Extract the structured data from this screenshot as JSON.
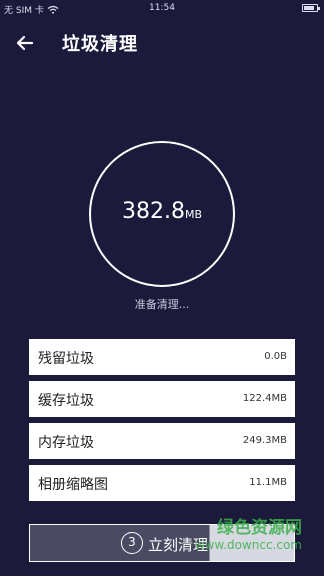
{
  "status_bar": {
    "carrier": "无 SIM 卡",
    "time": "11:54"
  },
  "header": {
    "title": "垃圾清理"
  },
  "summary": {
    "size_value": "382.8",
    "size_unit": "MB",
    "status": "准备清理..."
  },
  "items": [
    {
      "label": "残留垃圾",
      "value": "0.0B"
    },
    {
      "label": "缓存垃圾",
      "value": "122.4MB"
    },
    {
      "label": "内存垃圾",
      "value": "249.3MB"
    },
    {
      "label": "相册缩略图",
      "value": "11.1MB"
    }
  ],
  "action": {
    "countdown": "3",
    "label": "立刻清理",
    "progress": 0.68
  },
  "watermark": {
    "text": "绿色资源网",
    "url": "www.downcc.com"
  },
  "colors": {
    "background": "#1b1a3b",
    "ring": "#ffffff",
    "watermark": "#3bb04a"
  }
}
